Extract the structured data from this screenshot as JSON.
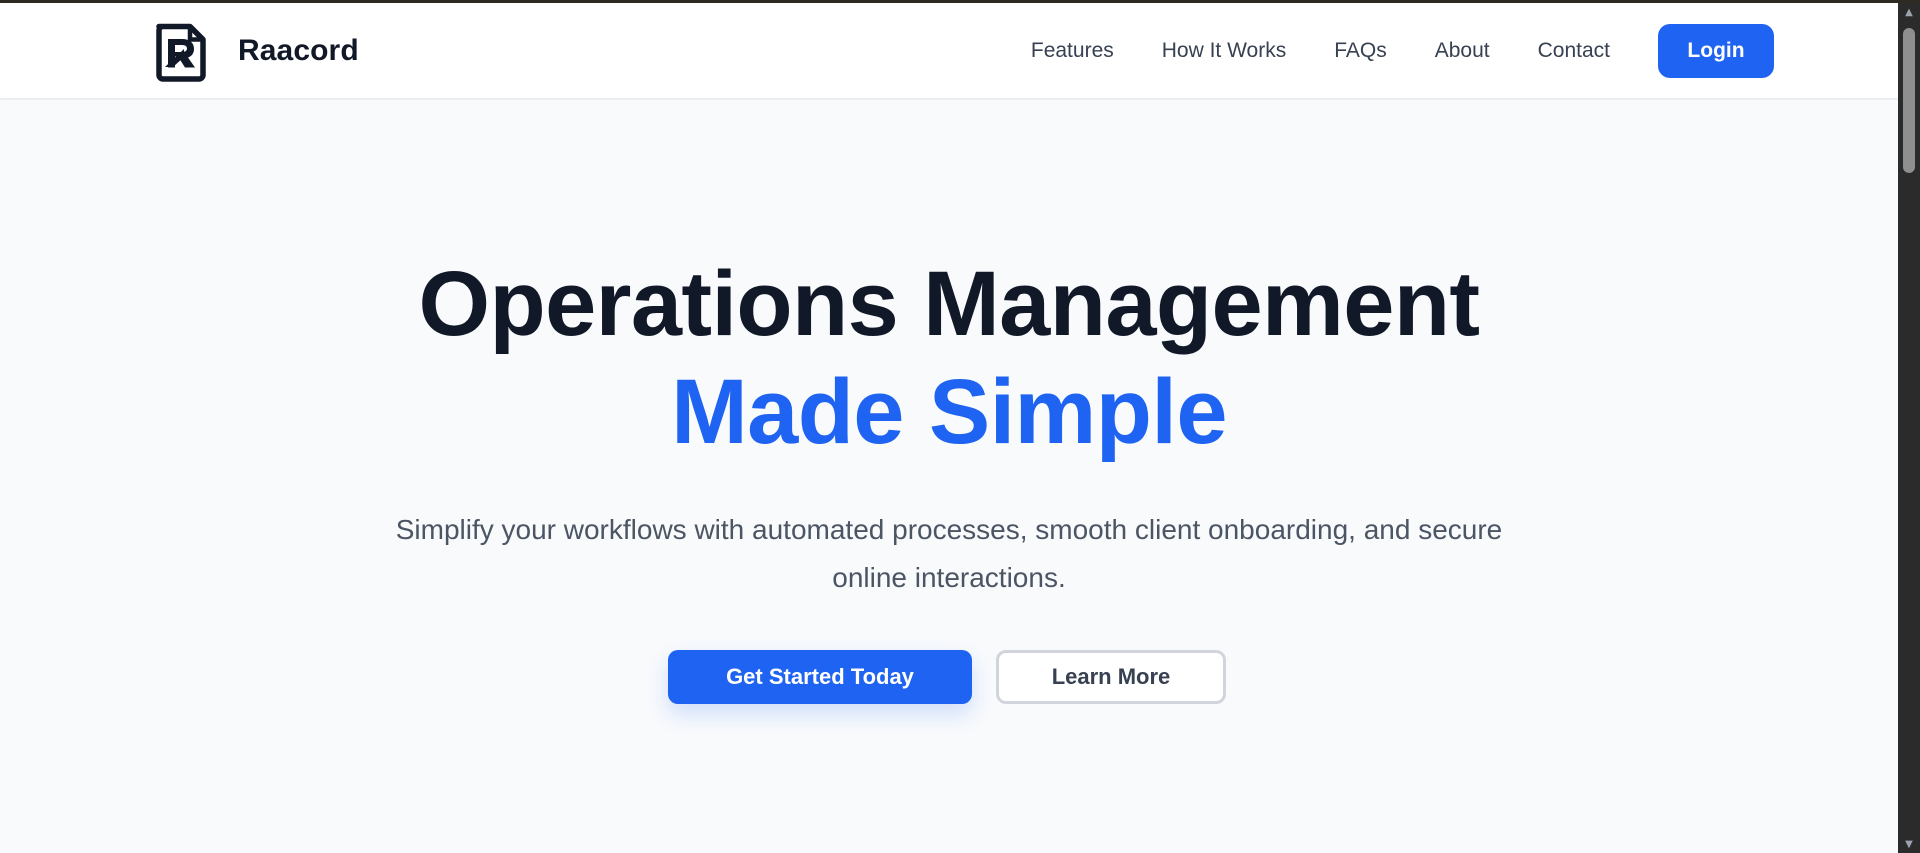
{
  "header": {
    "brand_name": "Raacord",
    "logo_icon": "document-r-logo-icon",
    "nav": {
      "features": "Features",
      "how_it_works": "How It Works",
      "faqs": "FAQs",
      "about": "About",
      "contact": "Contact"
    },
    "login_label": "Login"
  },
  "hero": {
    "title_line_1": "Operations Management",
    "title_line_2": "Made Simple",
    "subtitle": "Simplify your workflows with automated processes, smooth client onboarding, and secure online interactions.",
    "primary_cta": "Get Started Today",
    "secondary_cta": "Learn More"
  },
  "scrollbar": {
    "up_icon": "▲",
    "down_icon": "▼"
  },
  "colors": {
    "brand_blue": "#1f63f2",
    "heading": "#111827",
    "body_text": "#4b5563",
    "page_background": "#f8fafc"
  }
}
